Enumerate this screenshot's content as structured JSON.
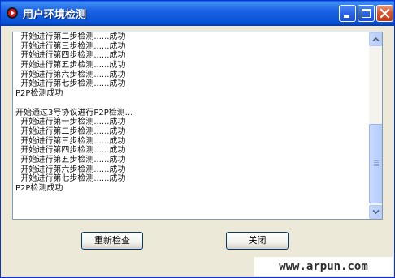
{
  "window": {
    "title": "用户环境检测"
  },
  "log": {
    "lines": [
      "  开始进行第二步检测......成功",
      "  开始进行第三步检测......成功",
      "  开始进行第四步检测......成功",
      "  开始进行第五步检测......成功",
      "  开始进行第六步检测......成功",
      "  开始进行第七步检测......成功",
      "P2P检测成功",
      "",
      "开始通过3号协议进行P2P检测...",
      "  开始进行第一步检测......成功",
      "  开始进行第二步检测......成功",
      "  开始进行第三步检测......成功",
      "  开始进行第四步检测......成功",
      "  开始进行第五步检测......成功",
      "  开始进行第六步检测......成功",
      "  开始进行第七步检测......成功",
      "P2P检测成功"
    ]
  },
  "buttons": {
    "recheck_label": "重新检查",
    "close_label": "关闭"
  },
  "watermark": "www.arpun.com",
  "icons": {
    "app": "app-icon",
    "minimize": "minimize-icon",
    "maximize": "maximize-icon",
    "close": "close-icon"
  },
  "colors": {
    "titlebar": "#0a5ee8",
    "window_bg": "#ece9d8",
    "close_button": "#d8552d"
  }
}
